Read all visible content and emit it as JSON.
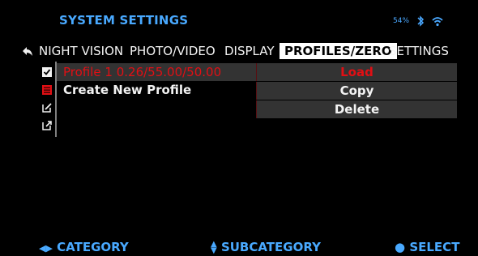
{
  "header": {
    "title": "SYSTEM SETTINGS",
    "battery": "54%",
    "status_icons": [
      "bluetooth-icon",
      "wifi-icon"
    ]
  },
  "tabs": {
    "items": [
      {
        "label": "NIGHT VISION",
        "active": false
      },
      {
        "label": "PHOTO/VIDEO",
        "active": false
      },
      {
        "label": "DISPLAY",
        "active": false
      },
      {
        "label": "PROFILES/ZERO",
        "active": true
      },
      {
        "label": "SETTINGS",
        "active": false
      }
    ]
  },
  "profiles": {
    "rows": [
      {
        "label": "Profile 1 0.26/55.00/50.00",
        "selected": true,
        "icon": "checkbox-checked-icon"
      },
      {
        "label": "Create New Profile",
        "selected": false,
        "icon": "add-profile-icon"
      },
      {
        "label": "",
        "selected": false,
        "icon": "edit-icon"
      },
      {
        "label": "",
        "selected": false,
        "icon": "export-icon"
      }
    ],
    "actions": [
      {
        "label": "Load",
        "selected": true
      },
      {
        "label": "Copy",
        "selected": false
      },
      {
        "label": "Delete",
        "selected": false
      }
    ]
  },
  "footer": {
    "category": "CATEGORY",
    "subcategory": "SUBCATEGORY",
    "select": "SELECT"
  },
  "colors": {
    "accent_blue": "#49a9ff",
    "selected_red": "#e10f14",
    "tab_active_bg": "#ffffff",
    "background": "#000000",
    "row_bg": "#333333"
  }
}
